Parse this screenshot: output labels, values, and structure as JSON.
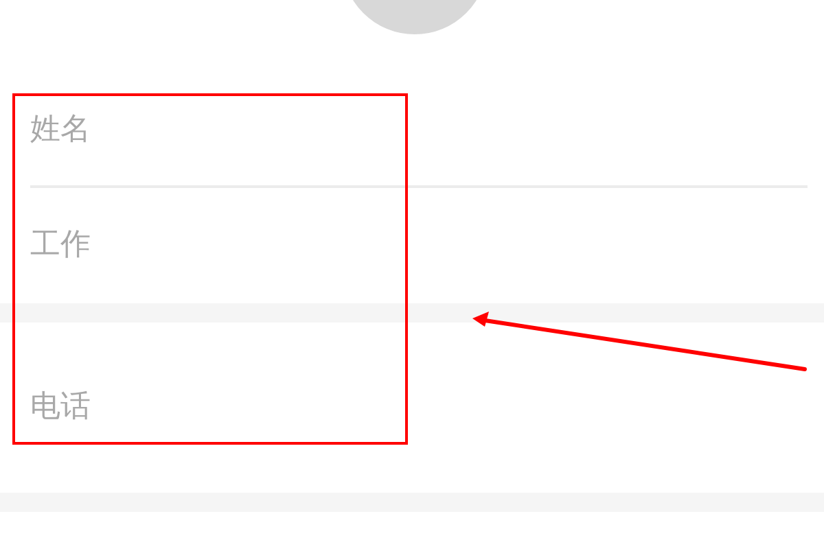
{
  "sections": [
    {
      "rows": [
        {
          "label": "姓名"
        },
        {
          "label": "工作"
        }
      ]
    },
    {
      "rows": [
        {
          "label": "电话"
        }
      ]
    }
  ]
}
